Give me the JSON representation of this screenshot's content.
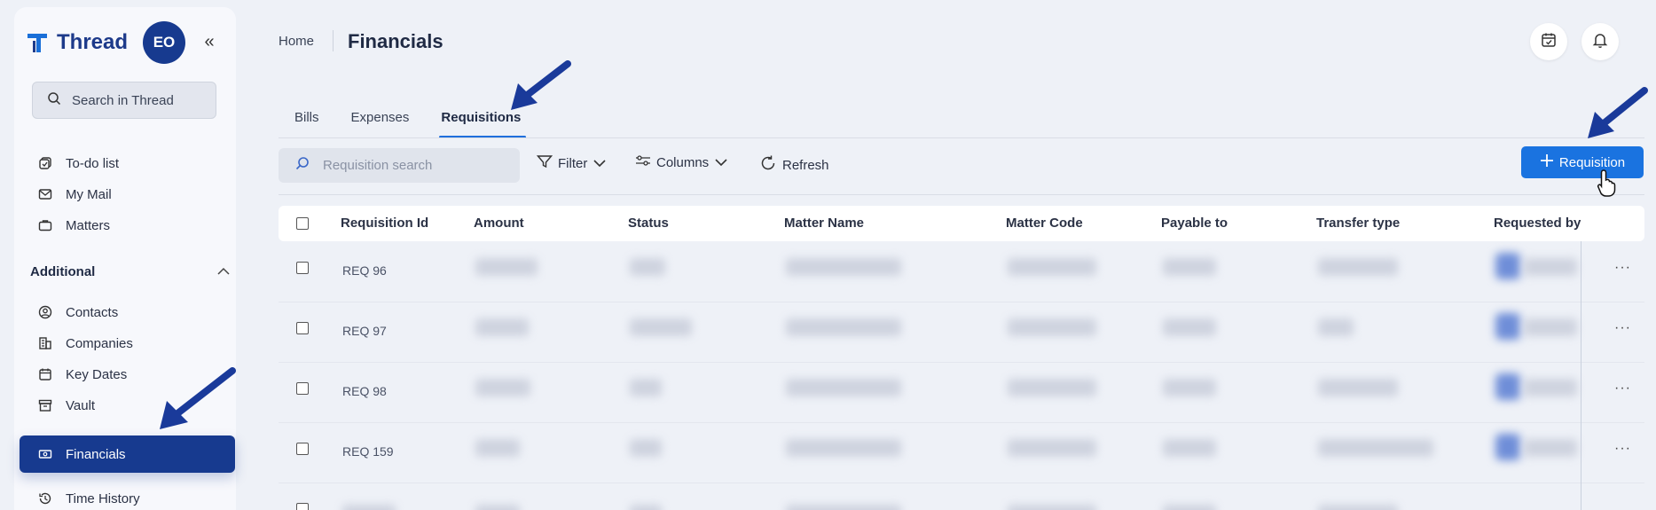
{
  "app": {
    "name": "Thread",
    "avatar_initials": "EO",
    "collapse_glyph": "«",
    "search_placeholder": "Search in Thread"
  },
  "sidebar": {
    "items_top": [
      {
        "label": "To-do list",
        "icon": "todo-icon"
      },
      {
        "label": "My Mail",
        "icon": "mail-icon"
      },
      {
        "label": "Matters",
        "icon": "briefcase-icon"
      }
    ],
    "section_label": "Additional",
    "items_additional": [
      {
        "label": "Contacts",
        "icon": "contact-icon"
      },
      {
        "label": "Companies",
        "icon": "building-icon"
      },
      {
        "label": "Key Dates",
        "icon": "calendar-icon"
      },
      {
        "label": "Vault",
        "icon": "archive-icon"
      },
      {
        "label": "Financials",
        "icon": "money-icon",
        "active": true
      },
      {
        "label": "Time History",
        "icon": "history-icon"
      }
    ]
  },
  "header": {
    "breadcrumb_home": "Home",
    "title": "Financials"
  },
  "tabs": [
    {
      "label": "Bills"
    },
    {
      "label": "Expenses"
    },
    {
      "label": "Requisitions",
      "active": true
    }
  ],
  "toolbar": {
    "search_placeholder": "Requisition search",
    "filter_label": "Filter",
    "columns_label": "Columns",
    "refresh_label": "Refresh",
    "add_label": "Requisition"
  },
  "table": {
    "columns": [
      "Requisition Id",
      "Amount",
      "Status",
      "Matter Name",
      "Matter Code",
      "Payable to",
      "Transfer type",
      "Requested by"
    ],
    "rows": [
      {
        "id": "REQ 96"
      },
      {
        "id": "REQ 97"
      },
      {
        "id": "REQ 98"
      },
      {
        "id": "REQ 159"
      },
      {
        "id": ""
      }
    ],
    "row_menu": "···"
  },
  "colors": {
    "brand_navy": "#173a8f",
    "primary_button": "#1a73e0",
    "arrow": "#1a3a9a"
  }
}
